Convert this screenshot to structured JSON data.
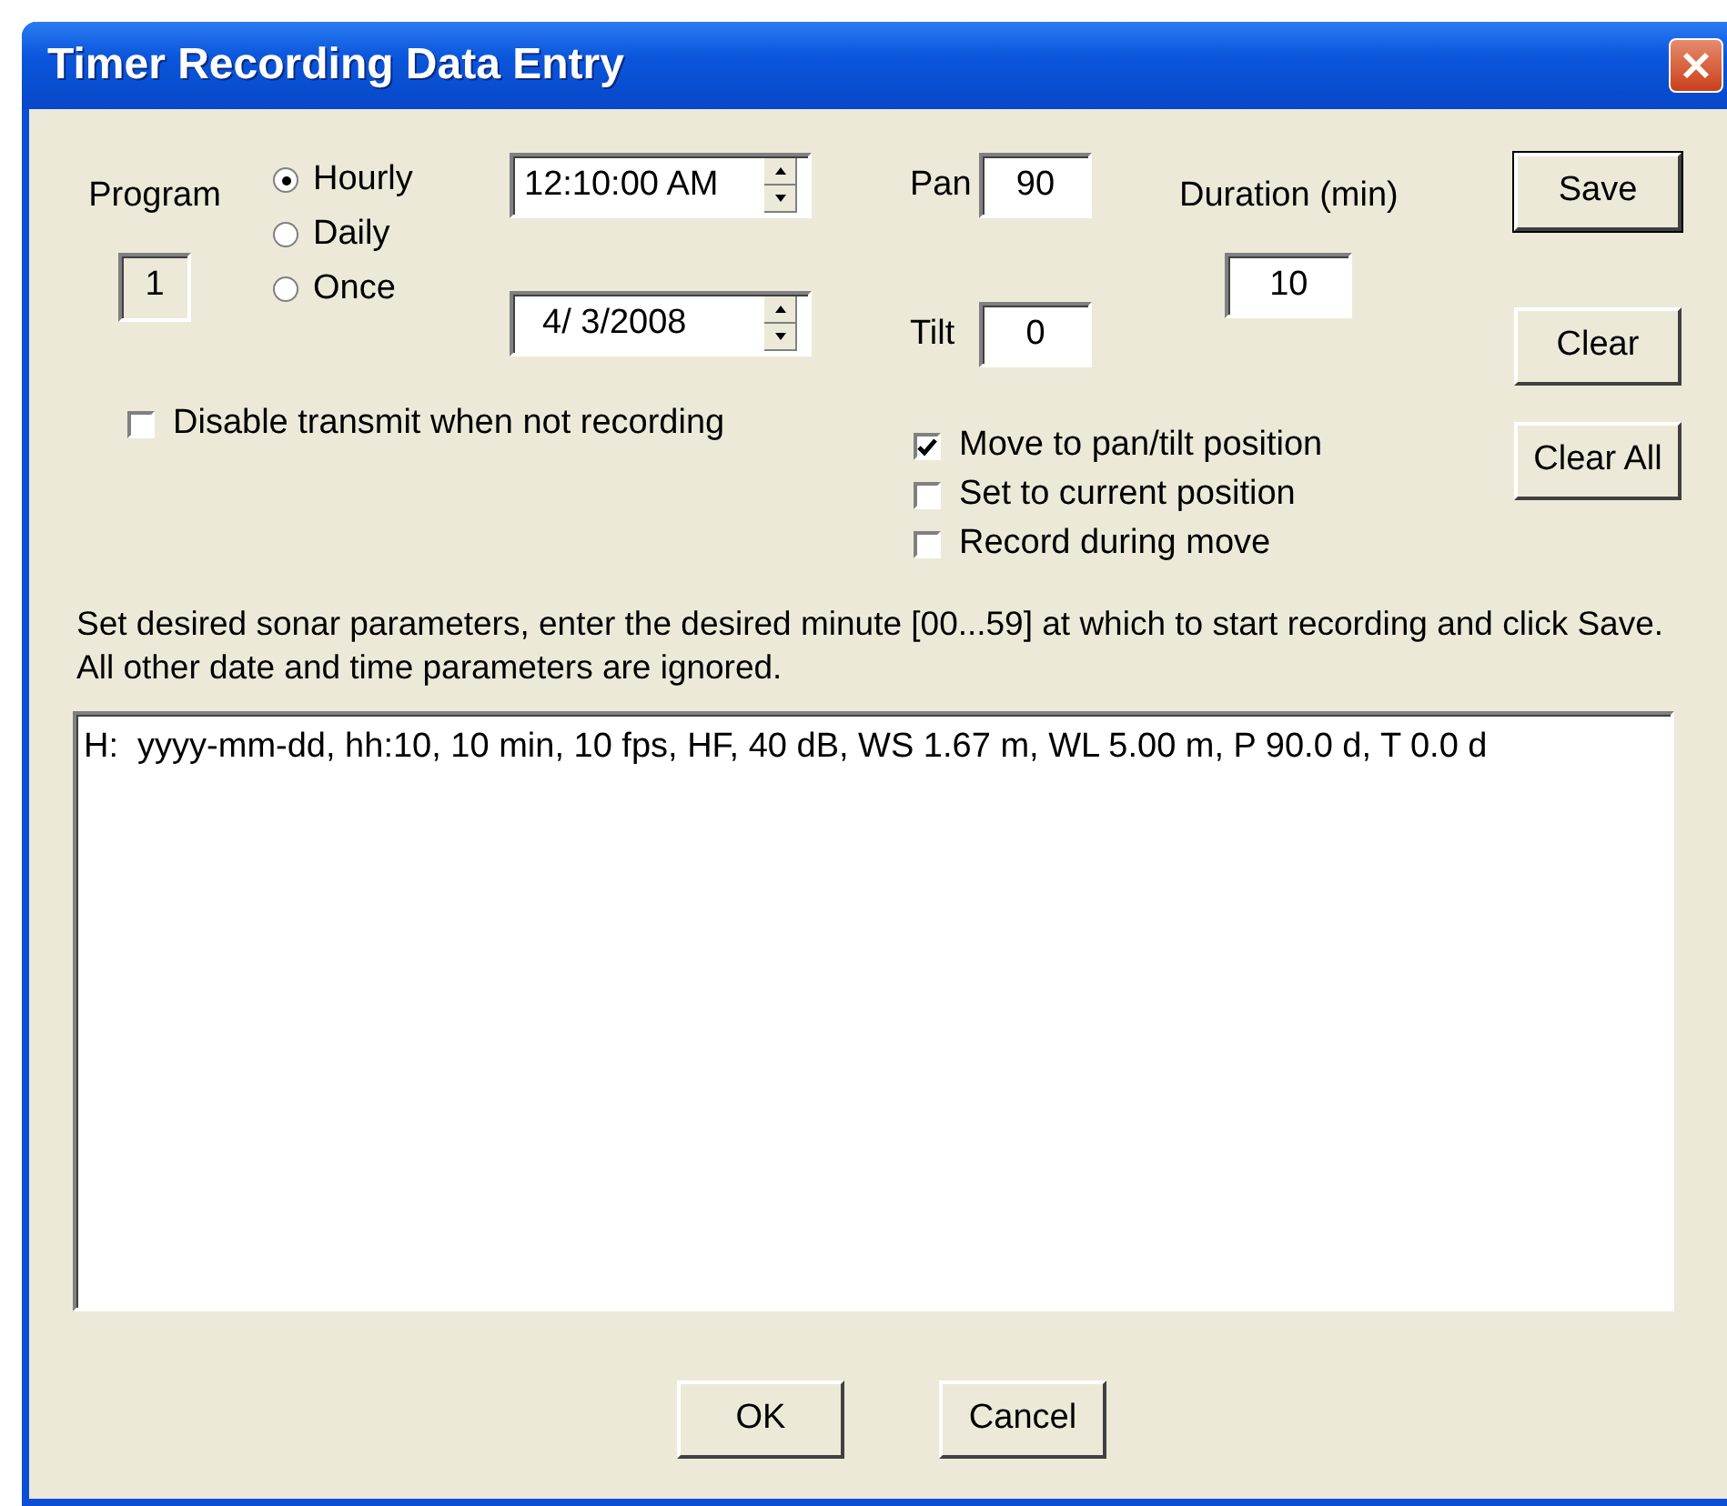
{
  "window": {
    "title": "Timer Recording Data Entry"
  },
  "program": {
    "label": "Program",
    "value": "1"
  },
  "schedule": [
    {
      "label": "Hourly",
      "selected": true
    },
    {
      "label": "Daily",
      "selected": false
    },
    {
      "label": "Once",
      "selected": false
    }
  ],
  "time_field": {
    "value": "12:10:00 AM"
  },
  "date_field": {
    "value": "4/ 3/2008"
  },
  "disable_transmit": {
    "label": "Disable transmit when not recording",
    "checked": false
  },
  "pan": {
    "label": "Pan",
    "value": "90"
  },
  "tilt": {
    "label": "Tilt",
    "value": "0"
  },
  "duration": {
    "label": "Duration (min)",
    "value": "10"
  },
  "move_options": [
    {
      "label": "Move to pan/tilt position",
      "checked": true
    },
    {
      "label": "Set to current position",
      "checked": false
    },
    {
      "label": "Record during move",
      "checked": false
    }
  ],
  "side_buttons": [
    {
      "label": "Save",
      "default": true
    },
    {
      "label": "Clear",
      "default": false
    },
    {
      "label": "Clear All",
      "default": false
    }
  ],
  "instructions": "Set desired sonar parameters, enter the desired minute [00...59] at which to start recording and click Save.  All other date and time parameters are ignored.",
  "entries": [
    "H:  yyyy-mm-dd, hh:10, 10 min, 10 fps, HF, 40 dB, WS 1.67 m, WL 5.00 m, P 90.0 d, T 0.0 d"
  ],
  "buttons": [
    "OK",
    "Cancel"
  ]
}
